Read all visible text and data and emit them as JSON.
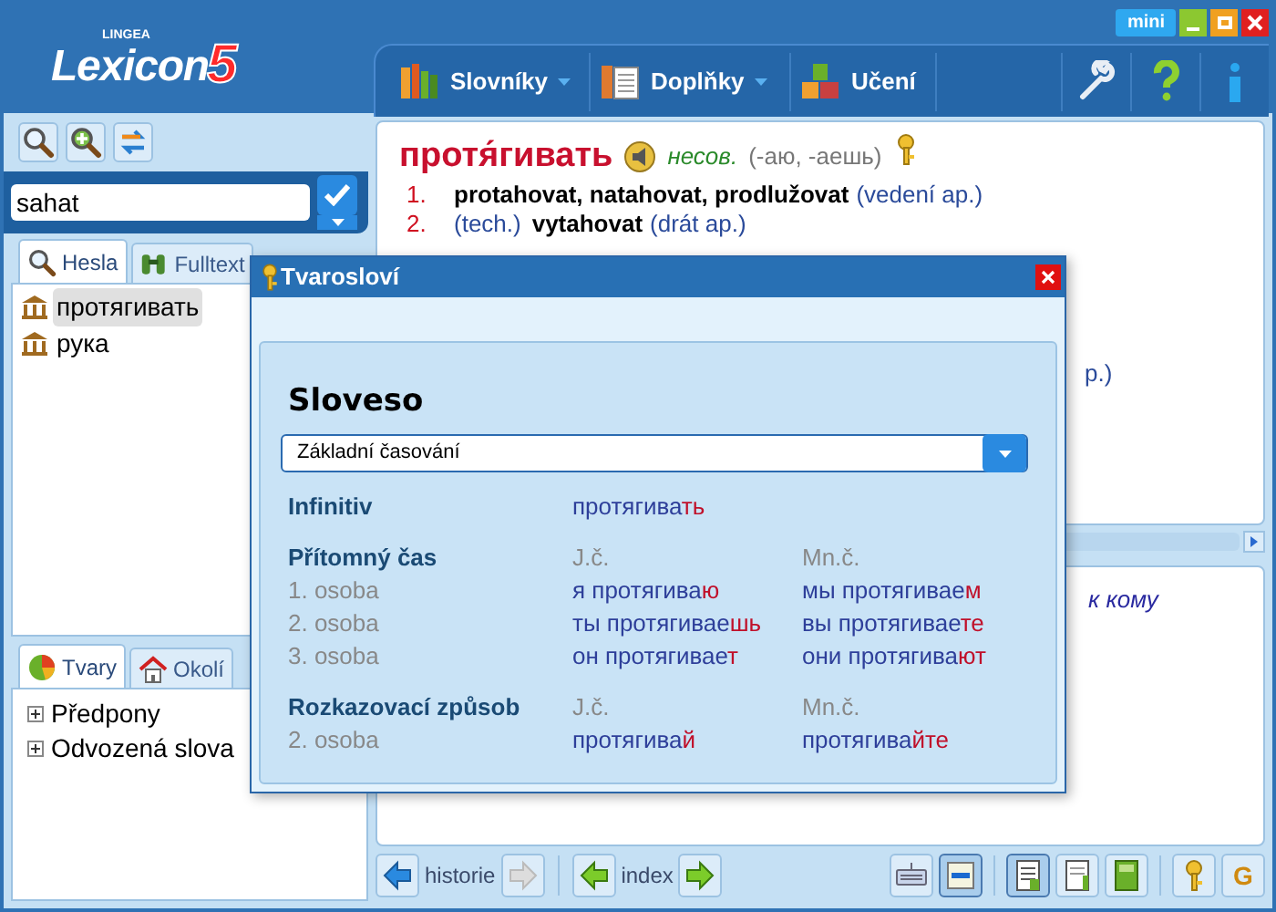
{
  "app": {
    "brand": "LINGEA",
    "logo": "Lexicon",
    "logo_number": "5",
    "mini_button": "mini"
  },
  "menu": [
    {
      "label": "Slovníky",
      "dropdown": true
    },
    {
      "label": "Doplňky",
      "dropdown": true
    },
    {
      "label": "Učení",
      "dropdown": false
    }
  ],
  "search": {
    "value": "sahat"
  },
  "search_tabs": [
    {
      "label": "Hesla",
      "selected": true
    },
    {
      "label": "Fulltext",
      "selected": false
    }
  ],
  "results": [
    {
      "label": "протягивать",
      "selected": true
    },
    {
      "label": "рука",
      "selected": false
    }
  ],
  "lower_tabs": [
    {
      "label": "Tvary",
      "selected": true
    },
    {
      "label": "Okolí",
      "selected": false
    }
  ],
  "tree": [
    {
      "label": "Předpony",
      "expanded": false
    },
    {
      "label": "Odvozená slova",
      "expanded": false
    }
  ],
  "entry": {
    "headword": "протя́гивать",
    "grammar": "несов.",
    "forms": "(-аю, -аешь)",
    "senses": [
      {
        "number": "1.",
        "translation": "protahovat, natahovat, prodlužovat",
        "note": "(vedení ap.)"
      },
      {
        "number": "2.",
        "domain": "(tech.)",
        "translation": "vytahovat",
        "note": "(drát ap.)"
      }
    ],
    "hidden_fragment": "p.)"
  },
  "lower_entry": {
    "fragment": "к кому"
  },
  "bottom_bar": {
    "history_label": "historie",
    "index_label": "index",
    "tools": [
      {
        "pressed": false
      },
      {
        "pressed": true
      },
      {
        "pressed": true
      },
      {
        "pressed": false
      },
      {
        "pressed": false
      },
      {
        "pressed": false
      },
      {
        "pressed": false,
        "text": "G"
      }
    ]
  },
  "dialog": {
    "title": "Tvarosloví",
    "heading": "Sloveso",
    "select": "Základní časování",
    "sections": [
      {
        "label": "Infinitiv",
        "rows": [
          {
            "singular": {
              "stem": "протягива",
              "ending": "ть"
            }
          }
        ]
      },
      {
        "label": "Přítomný čas",
        "col1": "J.č.",
        "col2": "Mn.č.",
        "rows": [
          {
            "person": "1. osoba",
            "singular": {
              "stem": "я протягива",
              "ending": "ю"
            },
            "plural": {
              "stem": "мы протягивае",
              "ending": "м"
            }
          },
          {
            "person": "2. osoba",
            "singular": {
              "stem": "ты протягивае",
              "ending": "шь"
            },
            "plural": {
              "stem": "вы протягивае",
              "ending": "те"
            }
          },
          {
            "person": "3. osoba",
            "singular": {
              "stem": "он протягивае",
              "ending": "т"
            },
            "plural": {
              "stem": "они протягива",
              "ending": "ют"
            }
          }
        ]
      },
      {
        "label": "Rozkazovací způsob",
        "col1": "J.č.",
        "col2": "Mn.č.",
        "rows": [
          {
            "person": "2. osoba",
            "singular": {
              "stem": "протягива",
              "ending": "й"
            },
            "plural": {
              "stem": "протягива",
              "ending": "йте"
            }
          }
        ]
      }
    ]
  }
}
